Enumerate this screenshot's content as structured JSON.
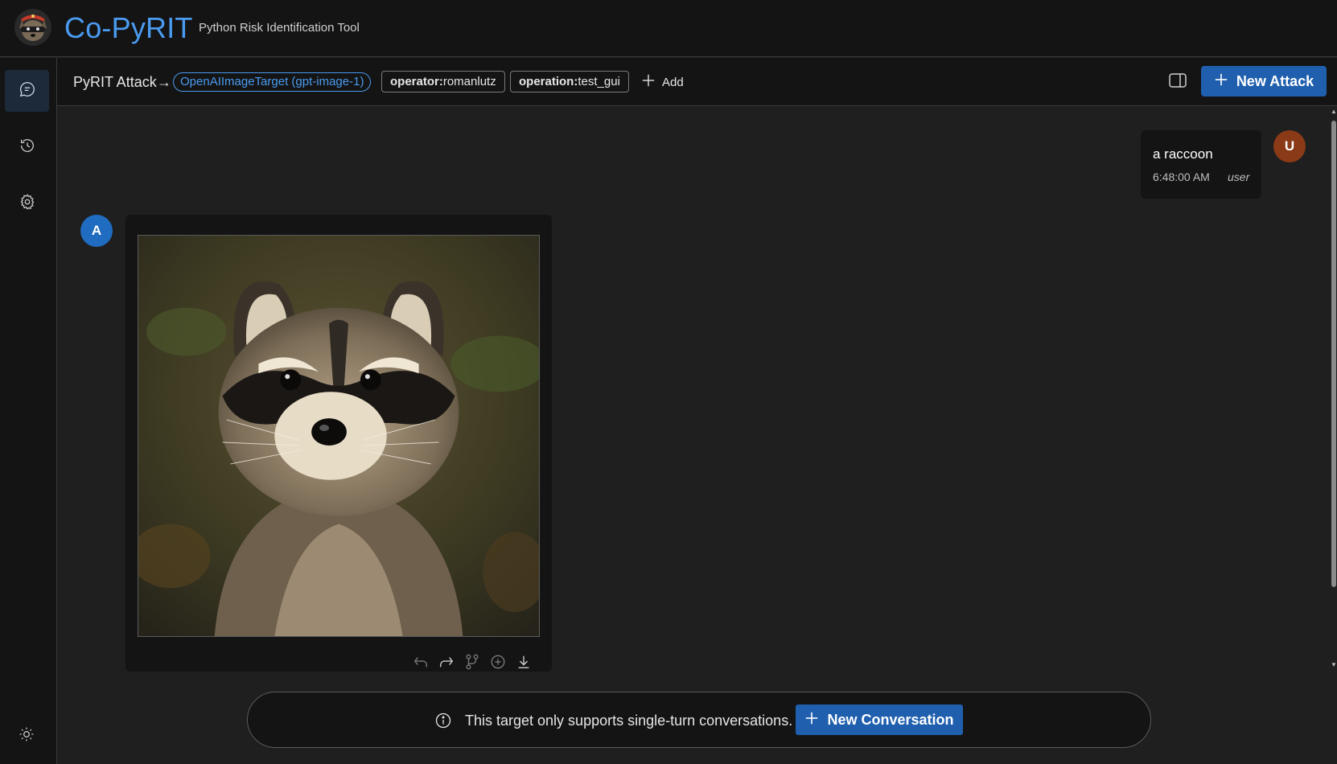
{
  "app": {
    "title": "Co-PyRIT",
    "subtitle": "Python Risk Identification Tool"
  },
  "rail": {
    "items": [
      {
        "icon": "chat-icon",
        "active": true
      },
      {
        "icon": "history-icon",
        "active": false
      },
      {
        "icon": "gear-icon",
        "active": false
      }
    ],
    "theme_icon": "sun-icon"
  },
  "toolbar": {
    "attack_title": "PyRIT Attack",
    "arrow": "→",
    "target": "OpenAIImageTarget (gpt-image-1)",
    "labels": [
      {
        "key": "operator:",
        "value": "romanlutz"
      },
      {
        "key": "operation:",
        "value": "test_gui"
      }
    ],
    "add_label": "Add",
    "new_attack_label": "New Attack"
  },
  "messages": {
    "user": {
      "avatar": "U",
      "text": "a raccoon",
      "time": "6:48:00 AM",
      "role": "user"
    },
    "assistant": {
      "avatar": "A",
      "image_icon": "raccoon-image",
      "actions": [
        "undo-icon",
        "redo-icon",
        "branch-icon",
        "add-comment-icon",
        "download-icon"
      ]
    }
  },
  "notice": {
    "text": "This target only supports single-turn conversations.",
    "button_label": "New Conversation"
  },
  "colors": {
    "accent": "#4a9bf0",
    "primary_button": "#1f5fae",
    "user_avatar": "#8a3a16",
    "assistant_avatar": "#1f6cc0"
  }
}
